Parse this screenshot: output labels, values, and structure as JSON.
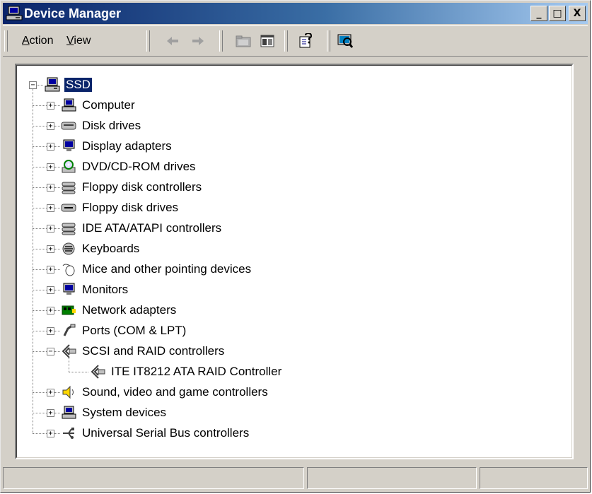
{
  "window": {
    "title": "Device Manager"
  },
  "caption_buttons": [
    "_",
    "□",
    "X"
  ],
  "menu": {
    "items": [
      {
        "label": "Action",
        "accel": "A"
      },
      {
        "label": "View",
        "accel": "V"
      }
    ]
  },
  "toolbar": {
    "buttons": [
      "back-icon",
      "forward-icon",
      "up-folder-icon",
      "show-hide-tree-icon",
      "help-icon",
      "scan-hardware-icon"
    ]
  },
  "tree": {
    "root": {
      "label": "SSD",
      "expanded": true,
      "selected": true
    },
    "items": [
      {
        "label": "Computer",
        "icon": "computer-icon",
        "expanded": false
      },
      {
        "label": "Disk drives",
        "icon": "disk-drive-icon",
        "expanded": false
      },
      {
        "label": "Display adapters",
        "icon": "display-adapter-icon",
        "expanded": false
      },
      {
        "label": "DVD/CD-ROM drives",
        "icon": "cdrom-icon",
        "expanded": false
      },
      {
        "label": "Floppy disk controllers",
        "icon": "floppy-controller-icon",
        "expanded": false
      },
      {
        "label": "Floppy disk drives",
        "icon": "floppy-drive-icon",
        "expanded": false
      },
      {
        "label": "IDE ATA/ATAPI controllers",
        "icon": "ide-controller-icon",
        "expanded": false
      },
      {
        "label": "Keyboards",
        "icon": "keyboard-icon",
        "expanded": false
      },
      {
        "label": "Mice and other pointing devices",
        "icon": "mouse-icon",
        "expanded": false
      },
      {
        "label": "Monitors",
        "icon": "monitor-icon",
        "expanded": false
      },
      {
        "label": "Network adapters",
        "icon": "network-adapter-icon",
        "expanded": false
      },
      {
        "label": "Ports (COM & LPT)",
        "icon": "port-icon",
        "expanded": false
      },
      {
        "label": "SCSI and RAID controllers",
        "icon": "scsi-icon",
        "expanded": true,
        "children": [
          {
            "label": "ITE IT8212 ATA RAID Controller",
            "icon": "scsi-icon"
          }
        ]
      },
      {
        "label": "Sound, video and game controllers",
        "icon": "sound-icon",
        "expanded": false
      },
      {
        "label": "System devices",
        "icon": "system-device-icon",
        "expanded": false
      },
      {
        "label": "Universal Serial Bus controllers",
        "icon": "usb-icon",
        "expanded": false
      }
    ]
  },
  "colors": {
    "title_gradient_start": "#0a246a",
    "title_gradient_end": "#a6caf0",
    "selection": "#0a246a",
    "face": "#d4d0c8"
  }
}
